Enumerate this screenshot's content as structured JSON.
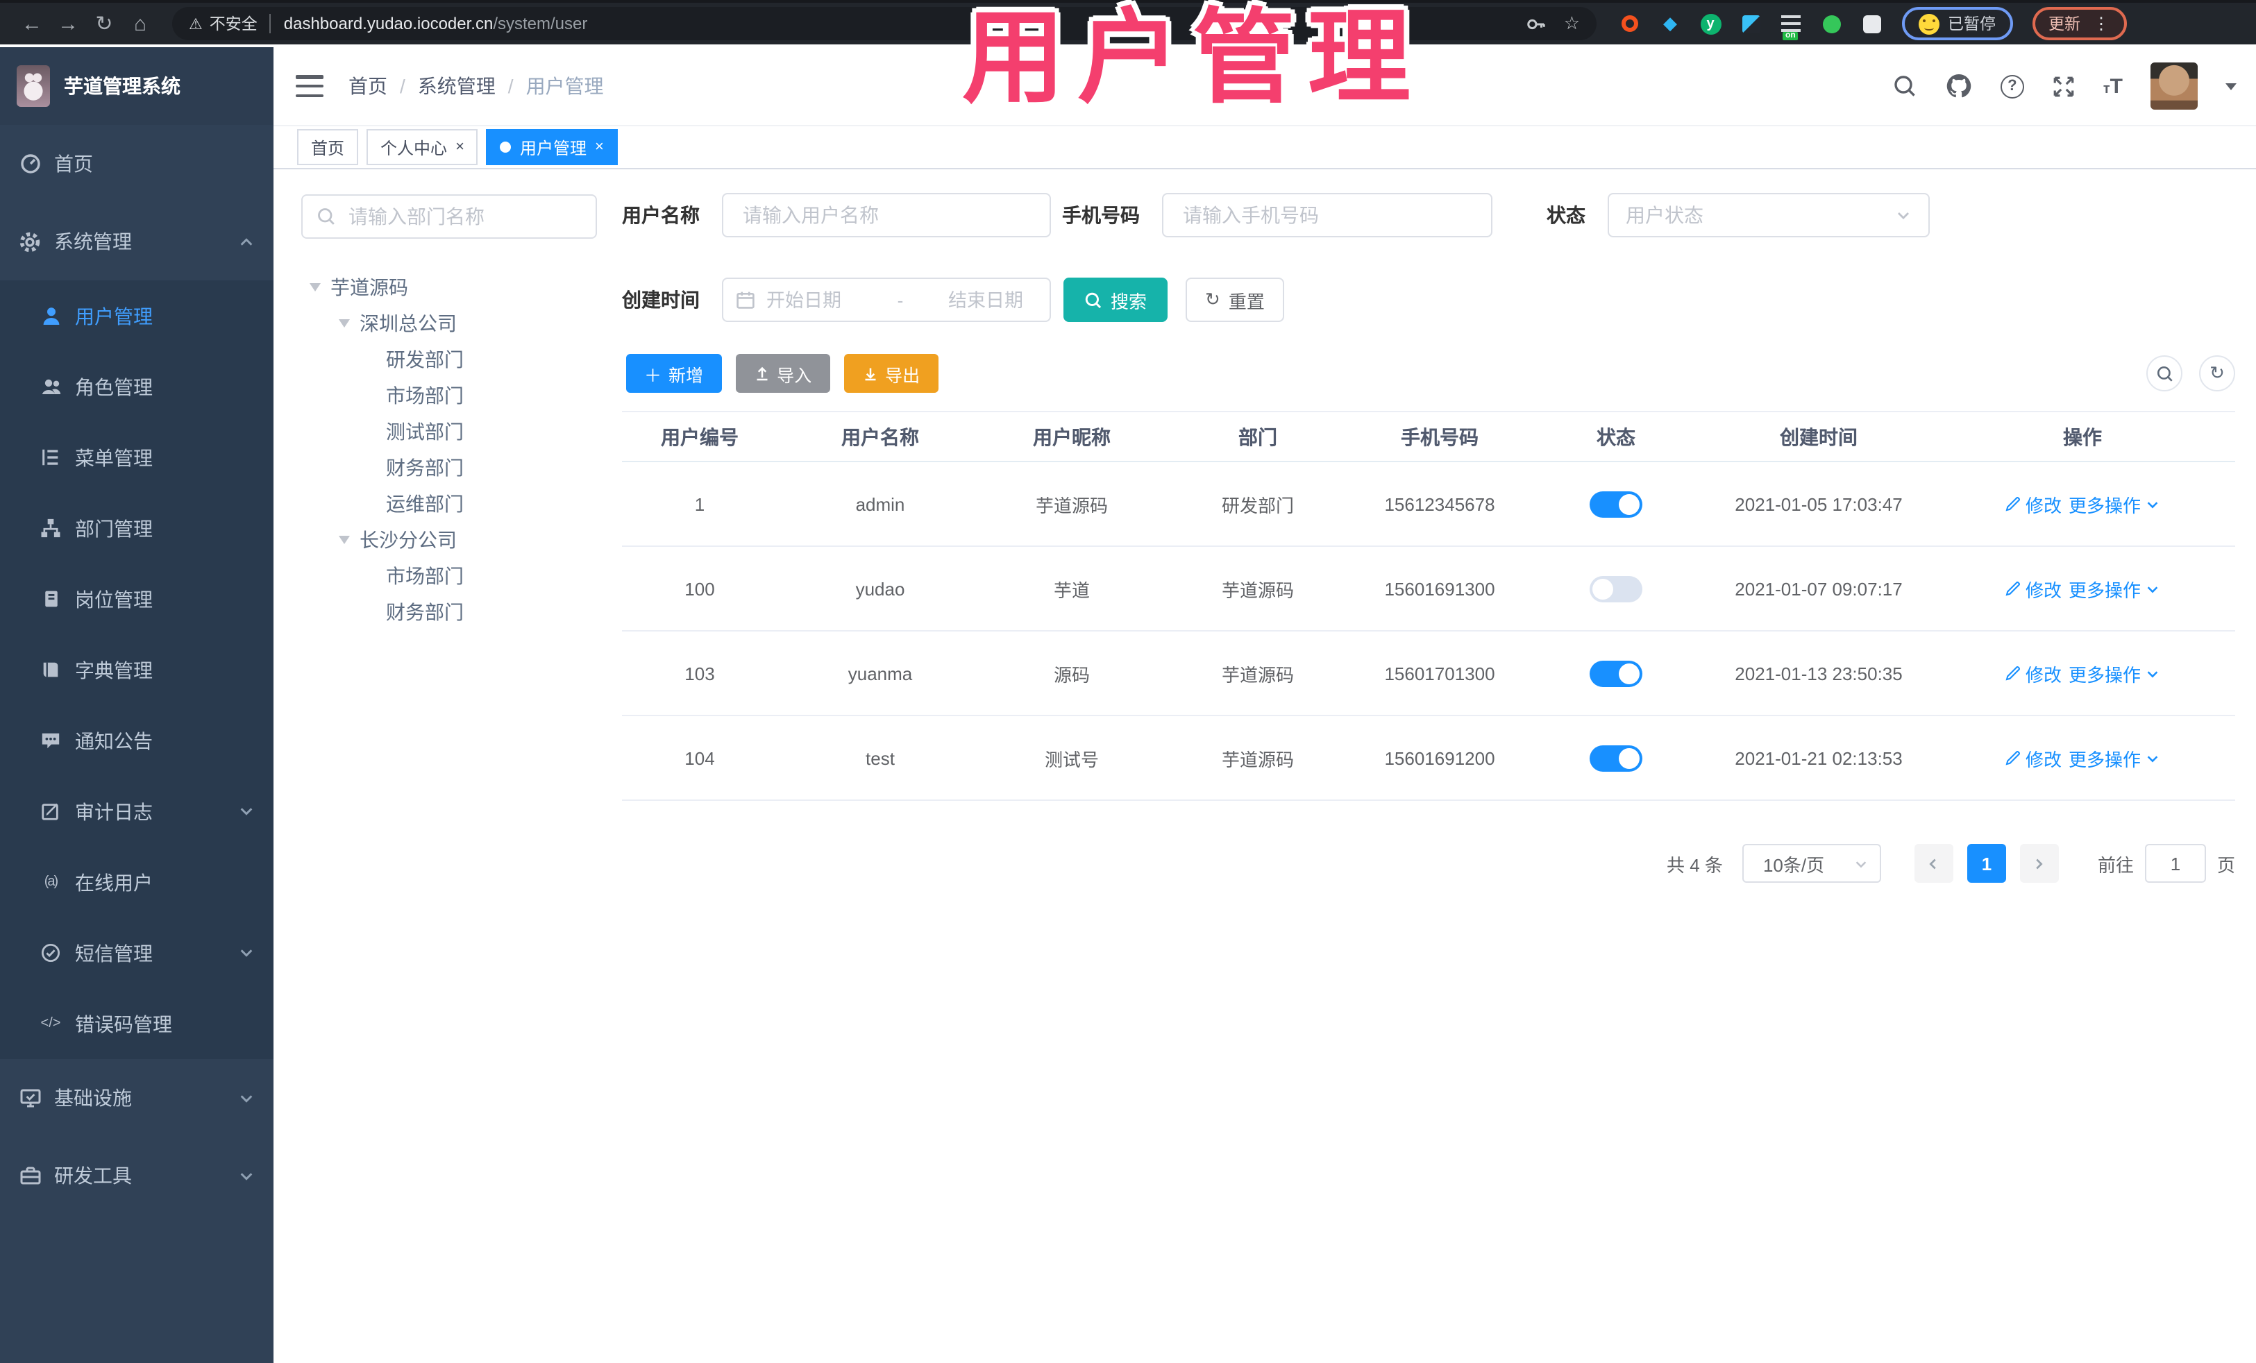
{
  "browser": {
    "security_label": "不安全",
    "url_host": "dashboard.yudao.iocoder.cn",
    "url_path": "/system/user",
    "paused_badge": "已暂停",
    "update_label": "更新",
    "ext_on_badge": "on",
    "ext_y_badge": "y"
  },
  "annotation": {
    "title": "用户管理",
    "color": "#f43f6e"
  },
  "header": {
    "app_title": "芋道管理系统",
    "breadcrumb": [
      "首页",
      "系统管理",
      "用户管理"
    ]
  },
  "tabs": {
    "items": [
      {
        "label": "首页"
      },
      {
        "label": "个人中心",
        "close": "×"
      },
      {
        "label": "用户管理",
        "close": "×"
      }
    ]
  },
  "sidebar": {
    "items": [
      {
        "label": "首页"
      },
      {
        "label": "系统管理"
      },
      {
        "label": "用户管理"
      },
      {
        "label": "角色管理"
      },
      {
        "label": "菜单管理"
      },
      {
        "label": "部门管理"
      },
      {
        "label": "岗位管理"
      },
      {
        "label": "字典管理"
      },
      {
        "label": "通知公告"
      },
      {
        "label": "审计日志"
      },
      {
        "label": "在线用户"
      },
      {
        "label": "短信管理"
      },
      {
        "label": "错误码管理"
      },
      {
        "label": "基础设施"
      },
      {
        "label": "研发工具"
      }
    ]
  },
  "dept_panel": {
    "search_placeholder": "请输入部门名称",
    "tree": [
      {
        "label": "芋道源码"
      },
      {
        "label": "深圳总公司"
      },
      {
        "label": "研发部门"
      },
      {
        "label": "市场部门"
      },
      {
        "label": "测试部门"
      },
      {
        "label": "财务部门"
      },
      {
        "label": "运维部门"
      },
      {
        "label": "长沙分公司"
      },
      {
        "label": "市场部门"
      },
      {
        "label": "财务部门"
      }
    ]
  },
  "filter": {
    "username_label": "用户名称",
    "username_placeholder": "请输入用户名称",
    "mobile_label": "手机号码",
    "mobile_placeholder": "请输入手机号码",
    "status_label": "状态",
    "status_placeholder": "用户状态",
    "time_label": "创建时间",
    "start_placeholder": "开始日期",
    "range_separator": "-",
    "end_placeholder": "结束日期",
    "search_label": "搜索",
    "reset_label": "重置"
  },
  "toolbar": {
    "add_label": "新增",
    "import_label": "导入",
    "export_label": "导出"
  },
  "table": {
    "columns": [
      "用户编号",
      "用户名称",
      "用户昵称",
      "部门",
      "手机号码",
      "状态",
      "创建时间",
      "操作"
    ],
    "op": {
      "edit": "修改",
      "more": "更多操作"
    },
    "rows": [
      {
        "id": "1",
        "username": "admin",
        "nickname": "芋道源码",
        "dept": "研发部门",
        "mobile": "15612345678",
        "status_on": true,
        "created": "2021-01-05 17:03:47"
      },
      {
        "id": "100",
        "username": "yudao",
        "nickname": "芋道",
        "dept": "芋道源码",
        "mobile": "15601691300",
        "status_on": false,
        "created": "2021-01-07 09:07:17"
      },
      {
        "id": "103",
        "username": "yuanma",
        "nickname": "源码",
        "dept": "芋道源码",
        "mobile": "15601701300",
        "status_on": true,
        "created": "2021-01-13 23:50:35"
      },
      {
        "id": "104",
        "username": "test",
        "nickname": "测试号",
        "dept": "芋道源码",
        "mobile": "15601691200",
        "status_on": true,
        "created": "2021-01-21 02:13:53"
      }
    ]
  },
  "pagination": {
    "total_text": "共 4 条",
    "page_size": "10条/页",
    "current_page": "1",
    "goto_label": "前往",
    "goto_value": "1",
    "page_unit": "页"
  },
  "colors": {
    "accent": "#1890ff",
    "search_teal": "#16b3aa",
    "export_amber": "#f0a020",
    "sidebar_bg": "#304156",
    "annotation_pink": "#f43f6e"
  }
}
